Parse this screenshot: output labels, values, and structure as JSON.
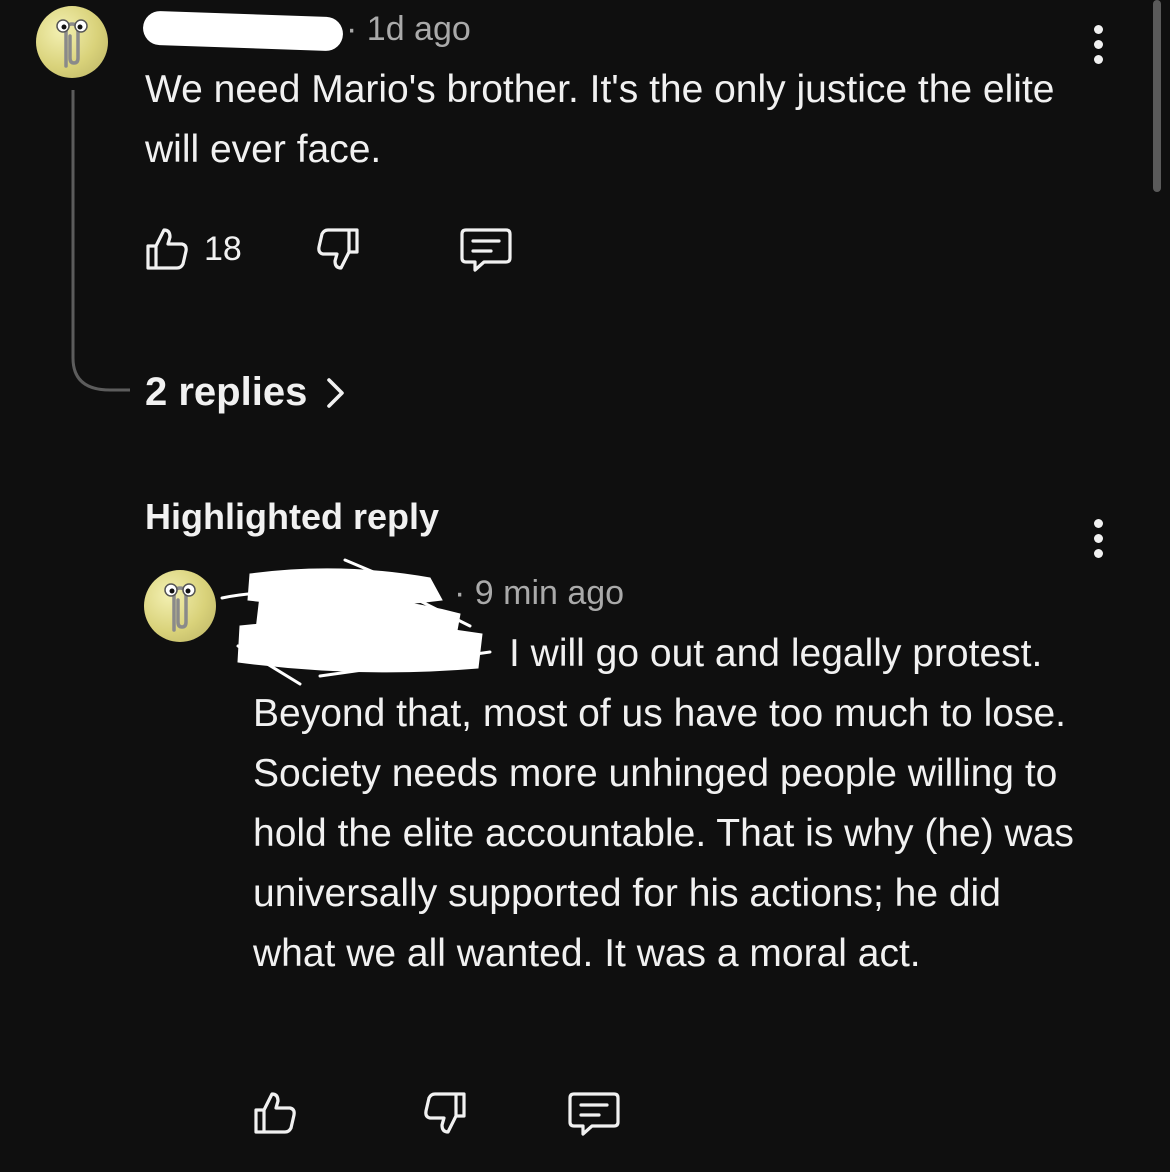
{
  "comment": {
    "username_redacted": "",
    "separator": "·",
    "time": "1d ago",
    "text": "We need Mario's brother. It's the only justice the elite will ever face.",
    "likes": "18",
    "replies_link": "2 replies",
    "avatar_icon": "paperclip-avatar-icon"
  },
  "highlighted": {
    "label": "Highlighted reply",
    "reply": {
      "separator": "·",
      "time": "9 min ago",
      "text": "I will go out and legally protest. Beyond that, most of us have too much to lose.  Society needs more unhinged people willing to hold the elite accountable. That is why (he) was universally supported for his actions; he did what we all wanted. It was a moral act.",
      "avatar_icon": "paperclip-avatar-icon"
    }
  },
  "colors": {
    "background": "#0f0f0f",
    "text": "#f1f1f1",
    "meta": "#aaaaaa"
  }
}
